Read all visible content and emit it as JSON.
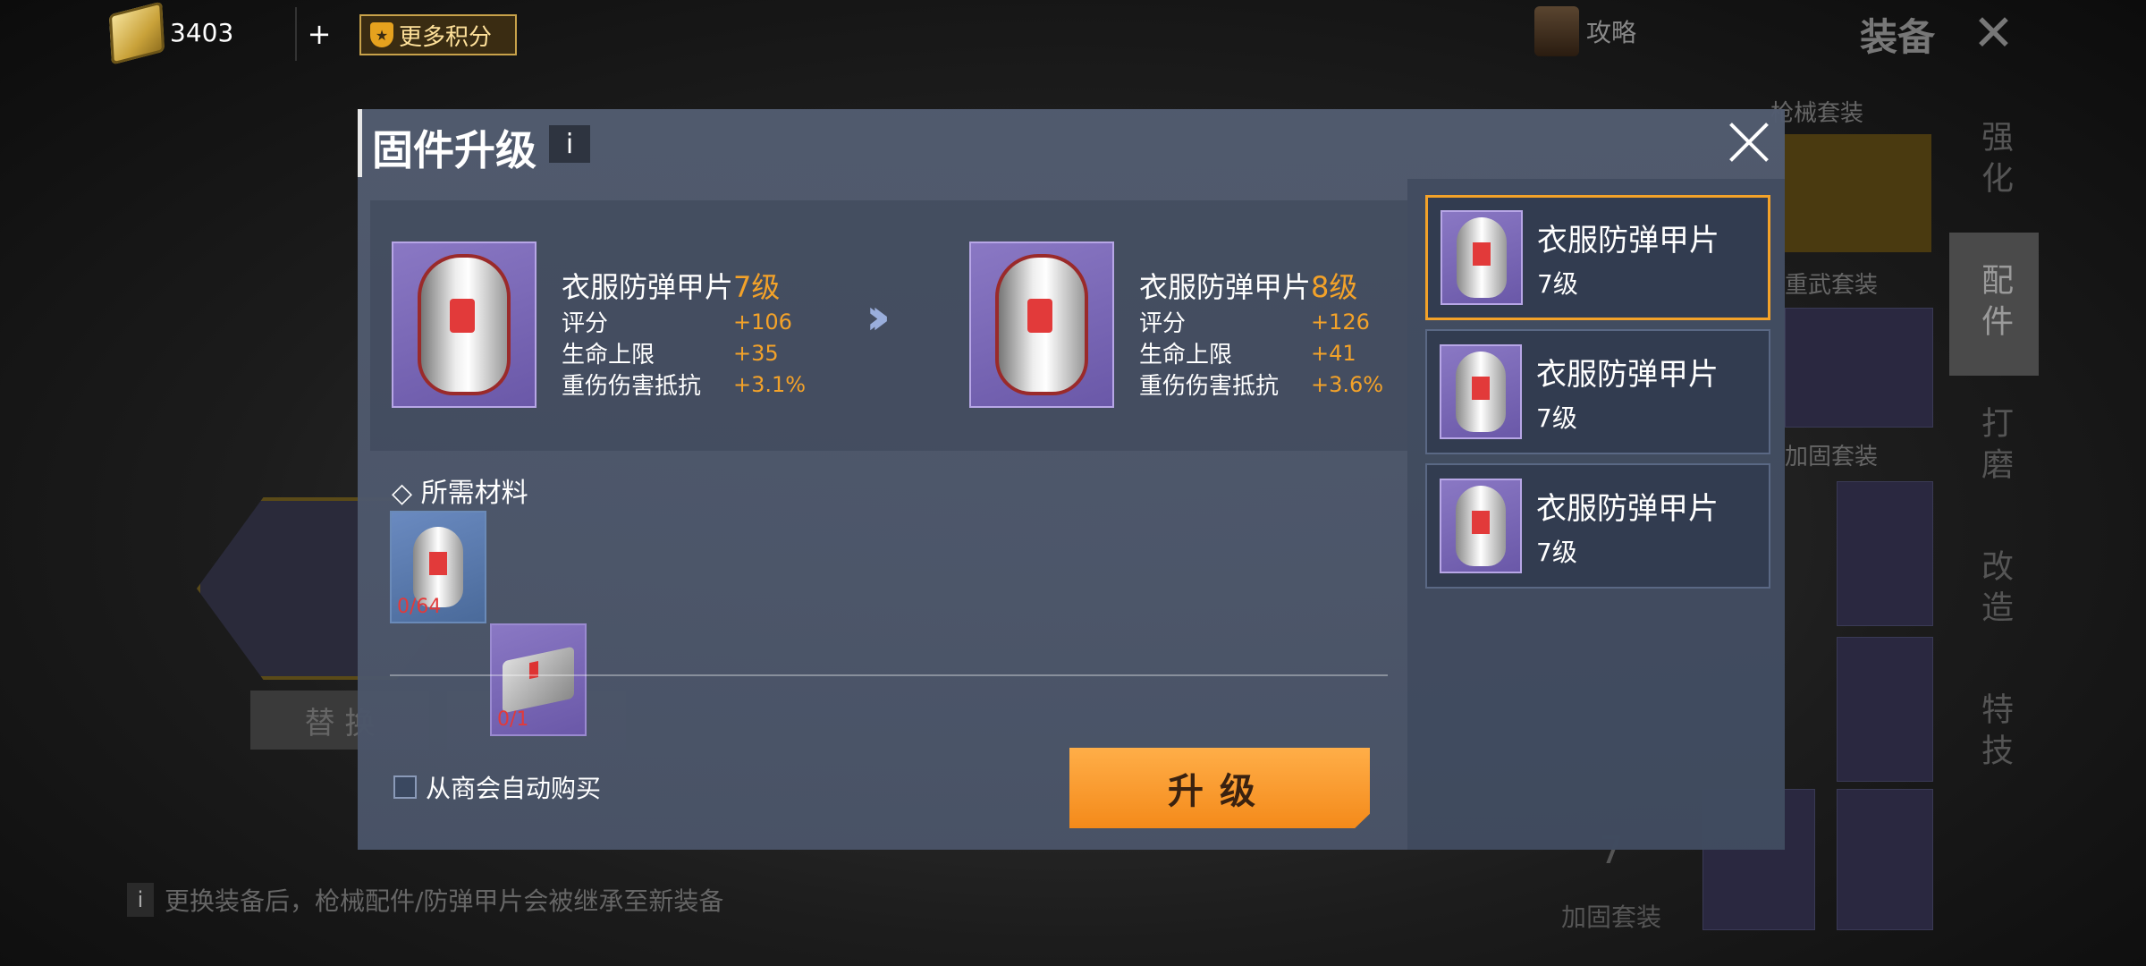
{
  "topbar": {
    "coins": "3403",
    "plus": "+",
    "more_points": "更多积分",
    "guide": "攻略",
    "title": "装备"
  },
  "background": {
    "side_tabs": [
      "强化",
      "配件",
      "打磨",
      "改造",
      "特技"
    ],
    "section_labels": [
      "枪械套装",
      "重武套装",
      "加固套装"
    ],
    "replace_btn": "替 换",
    "tip": "更换装备后，枪械配件/防弹甲片会被继承至新装备",
    "badge_level": "7",
    "badge_label": "加固套装"
  },
  "modal": {
    "title": "固件升级",
    "info": "i",
    "current": {
      "name": "衣服防弹甲片",
      "level": "7级",
      "stats": [
        {
          "label": "评分",
          "value": "+106"
        },
        {
          "label": "生命上限",
          "value": "+35"
        },
        {
          "label": "重伤伤害抵抗",
          "value": "+3.1%"
        }
      ]
    },
    "next": {
      "name": "衣服防弹甲片",
      "level": "8级",
      "stats": [
        {
          "label": "评分",
          "value": "+126"
        },
        {
          "label": "生命上限",
          "value": "+41"
        },
        {
          "label": "重伤伤害抵抗",
          "value": "+3.6%"
        }
      ]
    },
    "materials_title": "◇ 所需材料",
    "materials": [
      {
        "count": "0/64"
      },
      {
        "count": "0/1"
      }
    ],
    "auto_buy": "从商会自动购买",
    "upgrade": "升级",
    "list": [
      {
        "name": "衣服防弹甲片",
        "level": "7级"
      },
      {
        "name": "衣服防弹甲片",
        "level": "7级"
      },
      {
        "name": "衣服防弹甲片",
        "level": "7级"
      }
    ]
  },
  "colors": {
    "accent": "#f3a229",
    "upgrade_btn": "#f48a1a",
    "item_bg": "#7a68b8",
    "material_count": "#e23a3a"
  }
}
